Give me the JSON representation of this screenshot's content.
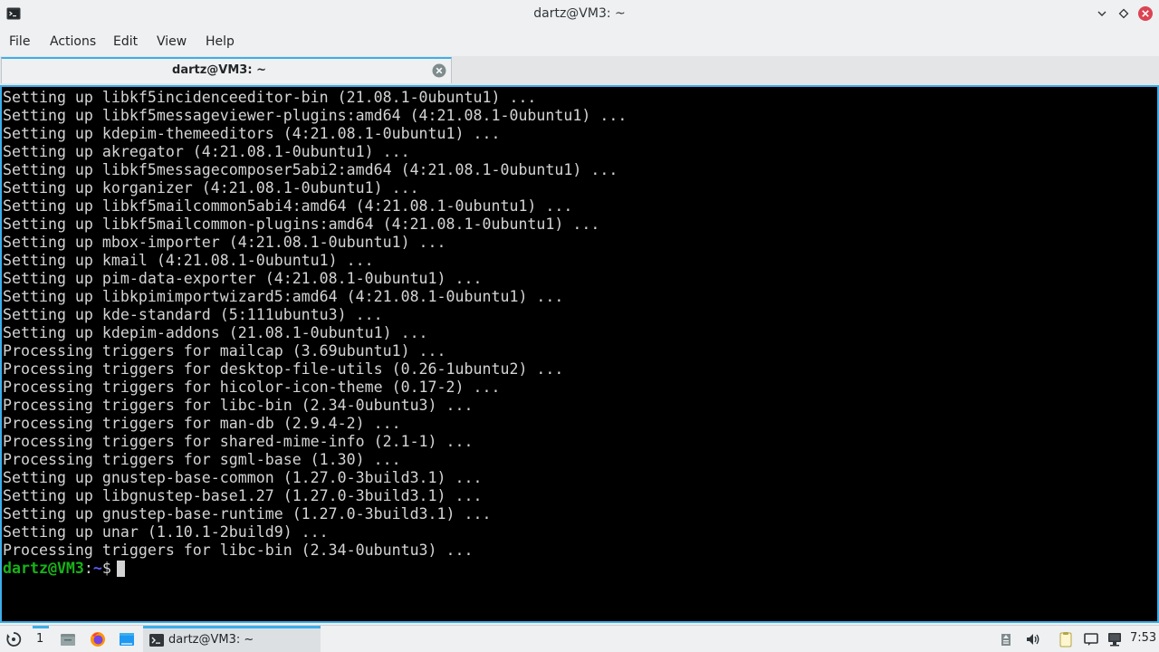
{
  "window": {
    "title": "dartz@VM3: ~",
    "app_icon": "terminal-icon"
  },
  "menu": {
    "items": [
      "File",
      "Actions",
      "Edit",
      "View",
      "Help"
    ]
  },
  "tabs": [
    {
      "label": "dartz@VM3: ~",
      "active": true
    }
  ],
  "terminal": {
    "lines": [
      "Setting up libkf5incidenceeditor-bin (21.08.1-0ubuntu1) ...",
      "Setting up libkf5messageviewer-plugins:amd64 (4:21.08.1-0ubuntu1) ...",
      "Setting up kdepim-themeeditors (4:21.08.1-0ubuntu1) ...",
      "Setting up akregator (4:21.08.1-0ubuntu1) ...",
      "Setting up libkf5messagecomposer5abi2:amd64 (4:21.08.1-0ubuntu1) ...",
      "Setting up korganizer (4:21.08.1-0ubuntu1) ...",
      "Setting up libkf5mailcommon5abi4:amd64 (4:21.08.1-0ubuntu1) ...",
      "Setting up libkf5mailcommon-plugins:amd64 (4:21.08.1-0ubuntu1) ...",
      "Setting up mbox-importer (4:21.08.1-0ubuntu1) ...",
      "Setting up kmail (4:21.08.1-0ubuntu1) ...",
      "Setting up pim-data-exporter (4:21.08.1-0ubuntu1) ...",
      "Setting up libkpimimportwizard5:amd64 (4:21.08.1-0ubuntu1) ...",
      "Setting up kde-standard (5:111ubuntu3) ...",
      "Setting up kdepim-addons (21.08.1-0ubuntu1) ...",
      "Processing triggers for mailcap (3.69ubuntu1) ...",
      "Processing triggers for desktop-file-utils (0.26-1ubuntu2) ...",
      "Processing triggers for hicolor-icon-theme (0.17-2) ...",
      "Processing triggers for libc-bin (2.34-0ubuntu3) ...",
      "Processing triggers for man-db (2.9.4-2) ...",
      "Processing triggers for shared-mime-info (2.1-1) ...",
      "Processing triggers for sgml-base (1.30) ...",
      "Setting up gnustep-base-common (1.27.0-3build3.1) ...",
      "Setting up libgnustep-base1.27 (1.27.0-3build3.1) ...",
      "Setting up gnustep-base-runtime (1.27.0-3build3.1) ...",
      "Setting up unar (1.10.1-2build9) ...",
      "Processing triggers for libc-bin (2.34-0ubuntu3) ..."
    ],
    "prompt": {
      "user_host": "dartz@VM3",
      "colon": ":",
      "path": "~",
      "symbol": "$"
    },
    "colors": {
      "background": "#000000",
      "foreground": "#d4d4d4",
      "prompt_user": "#18b218",
      "prompt_path": "#5c5cff",
      "focus_border": "#3daee9"
    }
  },
  "taskbar": {
    "launcher_icon": "application-launcher-icon",
    "desktop_number": "1",
    "pinned": [
      "file-manager-icon",
      "firefox-icon",
      "show-desktop-icon"
    ],
    "task": {
      "label": "dartz@VM3: ~",
      "icon": "terminal-icon"
    },
    "tray": [
      "package-updates-icon",
      "volume-icon",
      "clipboard-icon",
      "notifications-icon",
      "network-icon"
    ],
    "clock": "7:53"
  }
}
